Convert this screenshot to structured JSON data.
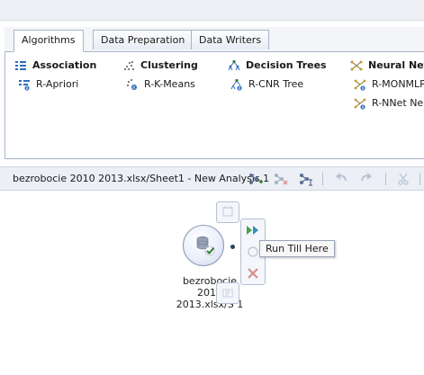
{
  "tabs": [
    "Algorithms",
    "Data Preparation",
    "Data Writers"
  ],
  "categories": [
    {
      "label": "Association",
      "icon": "association-icon"
    },
    {
      "label": "Clustering",
      "icon": "clustering-icon"
    },
    {
      "label": "Decision Trees",
      "icon": "decision-tree-icon"
    },
    {
      "label": "Neural Net",
      "icon": "neural-network-icon"
    }
  ],
  "algorithms": [
    {
      "label": "R-Apriori"
    },
    {
      "label": "R-K-Means"
    },
    {
      "label": "R-CNR Tree"
    },
    {
      "label": "R-MONMLP"
    },
    {
      "label": "R-NNet Neu"
    }
  ],
  "analysis_bar": {
    "breadcrumb": "bezrobocie 2010 2013.xlsx/Sheet1 - New Analysis 1"
  },
  "node": {
    "label_line1": "bezrobocie 2010",
    "label_line2": "2013.xlsx/S  1"
  },
  "tooltip": {
    "text": "Run Till Here"
  },
  "colors": {
    "accent": "#2f6fbf",
    "tree_green": "#2e7d32",
    "delete_red": "#d32f2f"
  }
}
